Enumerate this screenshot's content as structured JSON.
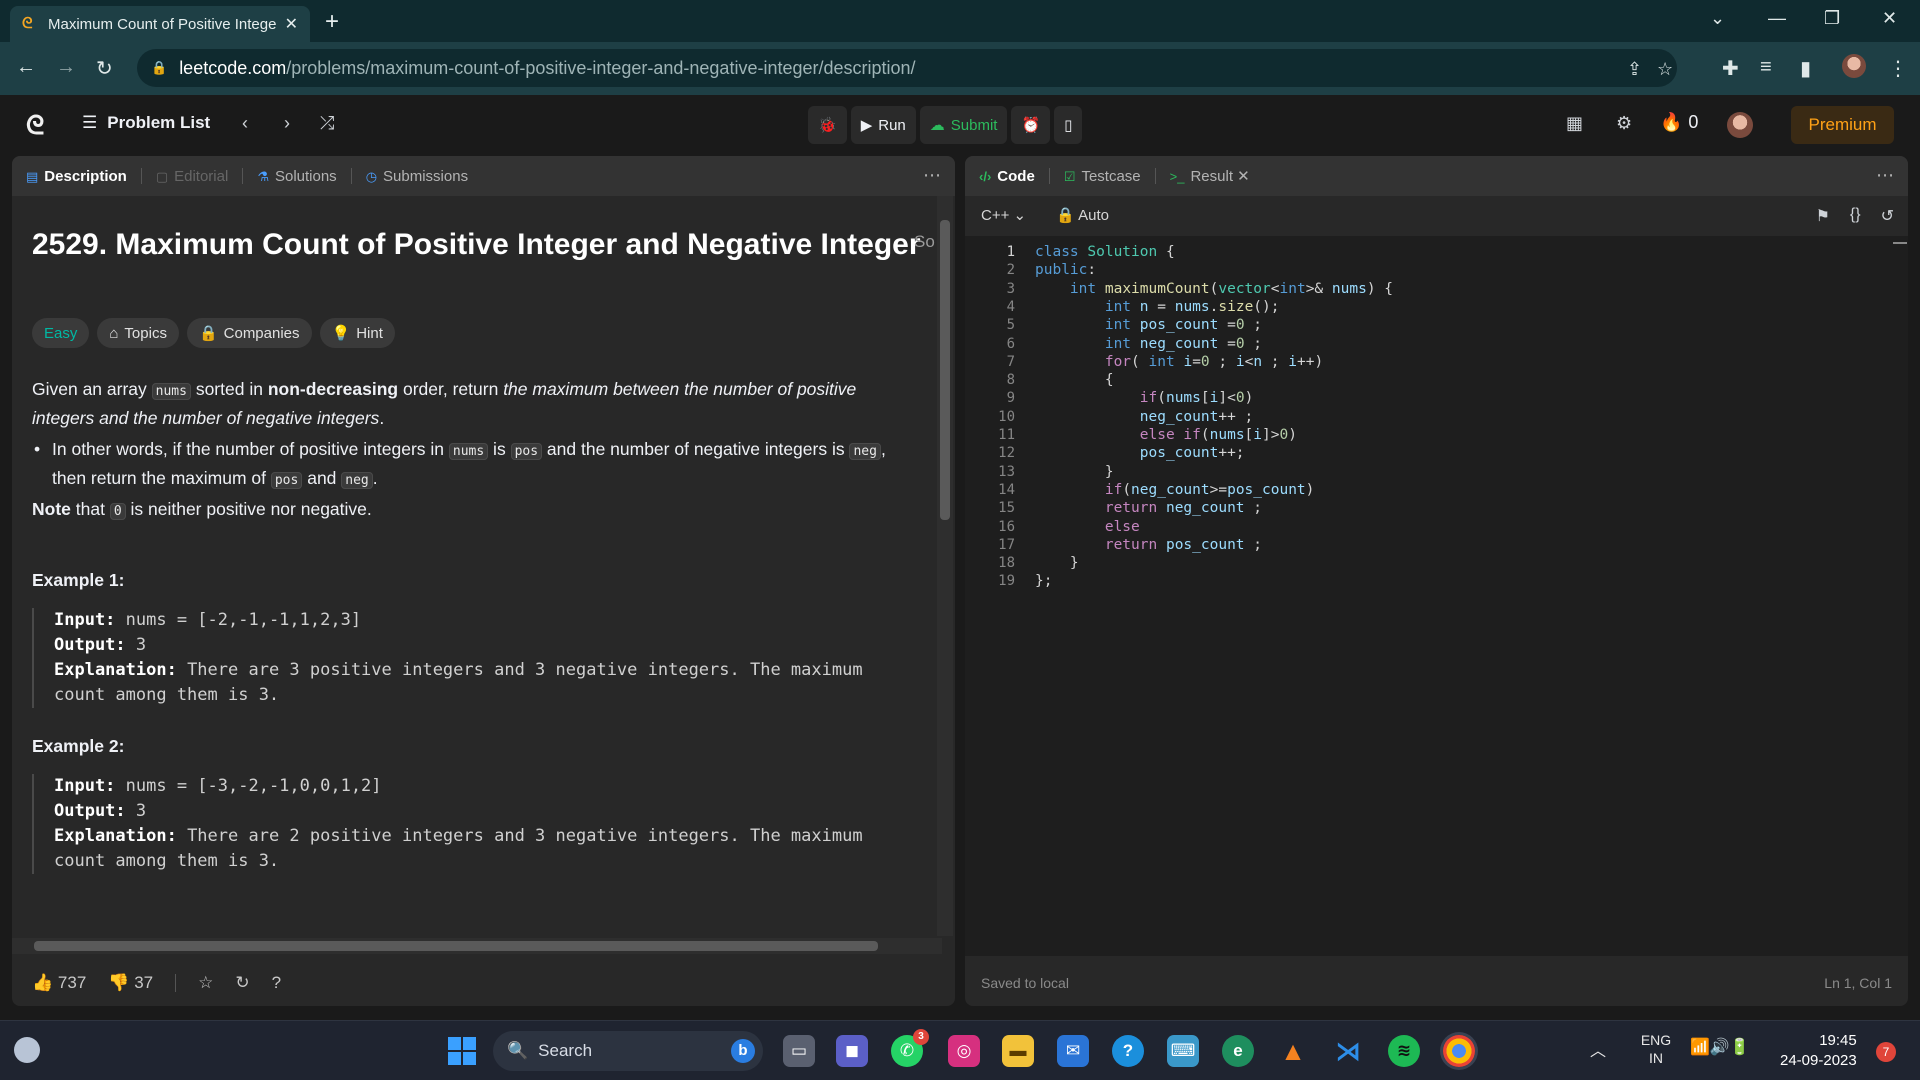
{
  "browser": {
    "tab_title": "Maximum Count of Positive Integer and Negative Integer - LeetCode",
    "url_host": "leetcode.com",
    "url_path": "/problems/maximum-count-of-positive-integer-and-negative-integer/description/"
  },
  "nav": {
    "problem_list": "Problem List",
    "run": "Run",
    "submit": "Submit",
    "streak": "0",
    "premium": "Premium"
  },
  "left": {
    "tabs": [
      "Description",
      "Editorial",
      "Solutions",
      "Submissions"
    ],
    "title": "2529. Maximum Count of Positive Integer and Negative Integer",
    "solved_hint": "So",
    "tags": [
      "Easy",
      "Topics",
      "Companies",
      "Hint"
    ],
    "p1a": "Given an array ",
    "p1code": "nums",
    "p1b": " sorted in ",
    "p1bold": "non-decreasing",
    "p1c": " order, return ",
    "p1em": "the maximum between the number of positive integers and the number of negative integers",
    "p1d": ".",
    "b1a": "In other words, if the number of positive integers in ",
    "b1c1": "nums",
    "b1b": " is ",
    "b1c2": "pos",
    "b1c": " and the number of negative integers is ",
    "b1c3": "neg",
    "b1d": ", then return the maximum of ",
    "b1c4": "pos",
    "b1e": " and ",
    "b1c5": "neg",
    "b1f": ".",
    "note_bold": "Note",
    "note_a": " that ",
    "note_code": "0",
    "note_b": " is neither positive nor negative.",
    "ex1_head": "Example 1:",
    "ex1_input_label": "Input:",
    "ex1_input": " nums = [-2,-1,-1,1,2,3]",
    "ex1_output_label": "Output:",
    "ex1_output": " 3",
    "ex1_expl_label": "Explanation:",
    "ex1_expl": " There are 3 positive integers and 3 negative integers. The maximum count among them is 3.",
    "ex2_head": "Example 2:",
    "ex2_input_label": "Input:",
    "ex2_input": " nums = [-3,-2,-1,0,0,1,2]",
    "ex2_output_label": "Output:",
    "ex2_output": " 3",
    "ex2_expl_label": "Explanation:",
    "ex2_expl": " There are 2 positive integers and 3 negative integers. The maximum count among them is 3.",
    "likes": "737",
    "dislikes": "37"
  },
  "right": {
    "tabs": [
      "Code",
      "Testcase",
      "Result"
    ],
    "language": "C++",
    "autosave": "Auto",
    "status_left": "Saved to local",
    "status_right": "Ln 1, Col 1",
    "line_numbers": [
      "1",
      "2",
      "3",
      "4",
      "5",
      "6",
      "7",
      "8",
      "9",
      "10",
      "11",
      "12",
      "13",
      "14",
      "15",
      "16",
      "17",
      "18",
      "19"
    ]
  },
  "taskbar": {
    "search": "Search",
    "lang_line1": "ENG",
    "lang_line2": "IN",
    "time": "19:45",
    "date": "24-09-2023",
    "notifications": "7",
    "whatsapp_badge": "3"
  }
}
